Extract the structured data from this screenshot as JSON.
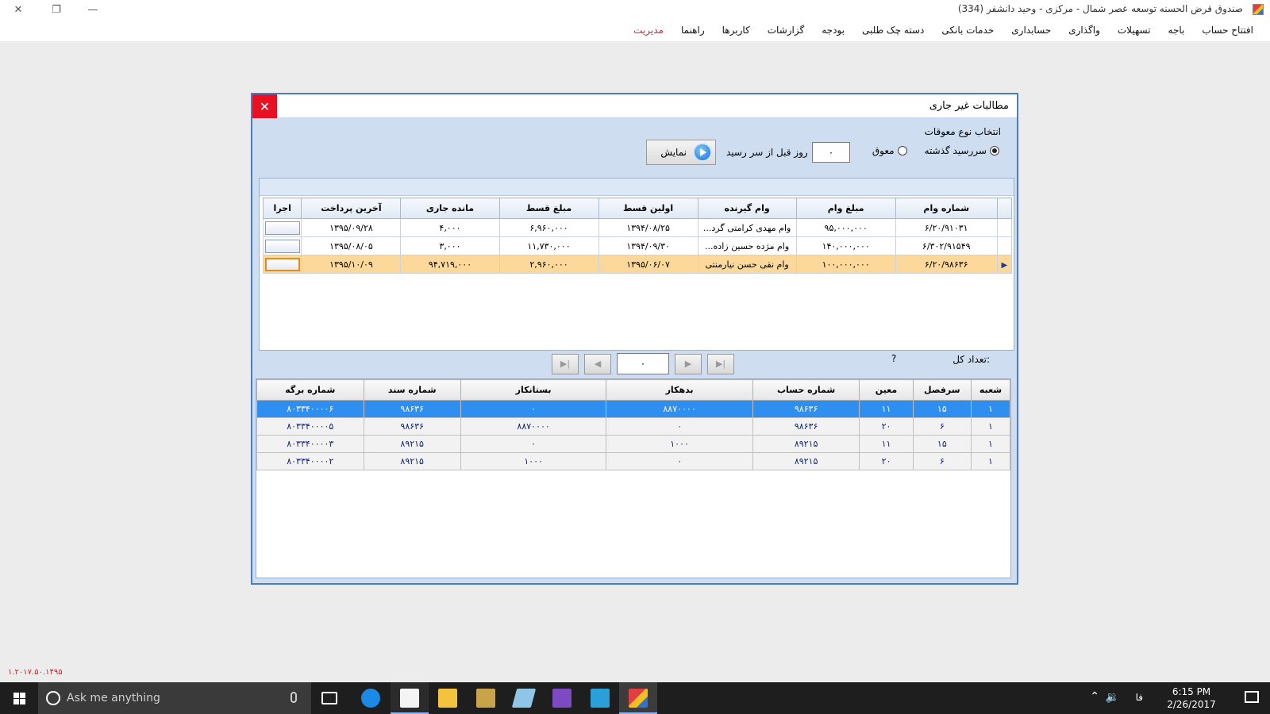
{
  "app": {
    "title": "صندوق قرض الحسنه توسعه عصر شمال - مرکزی - وحید دانشفر (334)"
  },
  "menu": [
    {
      "label": "افتتاح حساب",
      "accent": false
    },
    {
      "label": "باجه",
      "accent": false
    },
    {
      "label": "تسهیلات",
      "accent": false
    },
    {
      "label": "واگذاری",
      "accent": false
    },
    {
      "label": "حسابداری",
      "accent": false
    },
    {
      "label": "خدمات بانکی",
      "accent": false
    },
    {
      "label": "دسته چک طلبی",
      "accent": false
    },
    {
      "label": "بودجه",
      "accent": false
    },
    {
      "label": "گزارشات",
      "accent": false
    },
    {
      "label": "کاربرها",
      "accent": false
    },
    {
      "label": "راهنما",
      "accent": false
    },
    {
      "label": "مدیریت",
      "accent": true
    }
  ],
  "dialog": {
    "title": "مطالبات غیر جاری",
    "filter_title": "انتخاب نوع معوقات",
    "radio_overdue": "سررسید گذشته",
    "radio_delayed": "معوق",
    "days_value": "۰",
    "days_label": "روز قبل از سر رسید",
    "show_button": "نمایش",
    "total_label": "تعداد کل:",
    "total_value": "?",
    "page_value": "۰"
  },
  "loans": {
    "headers": {
      "loan_no": "شماره وام",
      "amount": "مبلغ وام",
      "borrower": "وام گیرنده",
      "first_inst": "اولین قسط",
      "inst_amount": "مبلغ قسط",
      "balance": "مانده جاری",
      "last_pay": "آخرین پرداخت",
      "exec": "اجرا"
    },
    "rows": [
      {
        "loan_no": "۶/۲۰/۹۱۰۳۱",
        "amount": "۹۵,۰۰۰,۰۰۰",
        "borrower": "وام مهدی کرامتی گرد...",
        "first_inst": "۱۳۹۴/۰۸/۲۵",
        "inst_amount": "۶,۹۶۰,۰۰۰",
        "balance": "۴,۰۰۰",
        "last_pay": "۱۳۹۵/۰۹/۲۸",
        "selected": false
      },
      {
        "loan_no": "۶/۳۰۲/۹۱۵۴۹",
        "amount": "۱۴۰,۰۰۰,۰۰۰",
        "borrower": "وام مژده حسین زاده...",
        "first_inst": "۱۳۹۴/۰۹/۳۰",
        "inst_amount": "۱۱,۷۳۰,۰۰۰",
        "balance": "۳,۰۰۰",
        "last_pay": "۱۳۹۵/۰۸/۰۵",
        "selected": false
      },
      {
        "loan_no": "۶/۲۰/۹۸۶۳۶",
        "amount": "۱۰۰,۰۰۰,۰۰۰",
        "borrower": "وام نقی حسن نیارمنتی",
        "first_inst": "۱۳۹۵/۰۶/۰۷",
        "inst_amount": "۲,۹۶۰,۰۰۰",
        "balance": "۹۴,۷۱۹,۰۰۰",
        "last_pay": "۱۳۹۵/۱۰/۰۹",
        "selected": true
      }
    ]
  },
  "vouchers": {
    "headers": {
      "branch": "شعبه",
      "general": "سرفصل",
      "sub": "معین",
      "account": "شماره حساب",
      "debit": "بدهکار",
      "credit": "بستانکار",
      "doc": "شماره سند",
      "sheet": "شماره برگه"
    },
    "rows": [
      {
        "branch": "۱",
        "general": "۱۵",
        "sub": "۱۱",
        "account": "۹۸۶۳۶",
        "debit": "۸۸۷۰۰۰۰",
        "credit": "۰",
        "doc": "۹۸۶۳۶",
        "sheet": "۸۰۳۳۴۰۰۰۰۶",
        "selected": true
      },
      {
        "branch": "۱",
        "general": "۶",
        "sub": "۲۰",
        "account": "۹۸۶۳۶",
        "debit": "۰",
        "credit": "۸۸۷۰۰۰۰",
        "doc": "۹۸۶۳۶",
        "sheet": "۸۰۳۳۴۰۰۰۰۵",
        "selected": false
      },
      {
        "branch": "۱",
        "general": "۱۵",
        "sub": "۱۱",
        "account": "۸۹۲۱۵",
        "debit": "۱۰۰۰",
        "credit": "۰",
        "doc": "۸۹۲۱۵",
        "sheet": "۸۰۳۳۴۰۰۰۰۳",
        "selected": false
      },
      {
        "branch": "۱",
        "general": "۶",
        "sub": "۲۰",
        "account": "۸۹۲۱۵",
        "debit": "۰",
        "credit": "۱۰۰۰",
        "doc": "۸۹۲۱۵",
        "sheet": "۸۰۳۳۴۰۰۰۰۲",
        "selected": false
      }
    ]
  },
  "version": "۱.۲۰۱۷.۵۰.۱۴۹۵",
  "taskbar": {
    "search_placeholder": "Ask me anything",
    "time": "6:15 PM",
    "date": "2/26/2017",
    "lang": "فا"
  },
  "colors": {
    "dialog_border": "#4a7cc8",
    "close_red": "#e81123",
    "selected_loan": "#fcd89a",
    "selected_voucher": "#2f8ff0",
    "admin_menu": "#c0282e"
  }
}
